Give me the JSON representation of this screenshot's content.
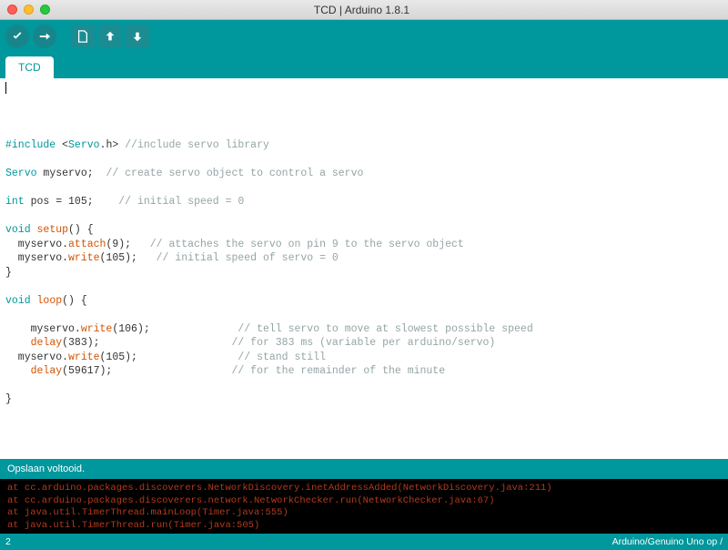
{
  "window": {
    "title": "TCD | Arduino 1.8.1"
  },
  "tabs": [
    {
      "label": "TCD"
    }
  ],
  "statusbar": {
    "text": "Opslaan voltooid."
  },
  "footer": {
    "left": "2",
    "right": "Arduino/Genuino Uno op /"
  },
  "console": {
    "lines": [
      "at cc.arduino.packages.discoverers.NetworkDiscovery.inetAddressAdded(NetworkDiscovery.java:211)",
      "at cc.arduino.packages.discoverers.network.NetworkChecker.run(NetworkChecker.java:67)",
      "at java.util.TimerThread.mainLoop(Timer.java:555)",
      "at java.util.TimerThread.run(Timer.java:505)"
    ]
  },
  "code": {
    "tokens": [
      [
        {
          "t": ""
        }
      ],
      [
        {
          "c": "kw",
          "t": "#include"
        },
        {
          "t": " <"
        },
        {
          "c": "ty",
          "t": "Servo"
        },
        {
          "t": ".h> "
        },
        {
          "c": "cm",
          "t": "//include servo library"
        }
      ],
      [
        {
          "t": ""
        }
      ],
      [
        {
          "c": "ty",
          "t": "Servo"
        },
        {
          "t": " myservo;  "
        },
        {
          "c": "cm",
          "t": "// create servo object to control a servo"
        }
      ],
      [
        {
          "t": ""
        }
      ],
      [
        {
          "c": "ty",
          "t": "int"
        },
        {
          "t": " pos = 105;    "
        },
        {
          "c": "cm",
          "t": "// initial speed = 0"
        }
      ],
      [
        {
          "t": ""
        }
      ],
      [
        {
          "c": "ty",
          "t": "void"
        },
        {
          "t": " "
        },
        {
          "c": "fn",
          "t": "setup"
        },
        {
          "t": "() {"
        }
      ],
      [
        {
          "t": "  myservo."
        },
        {
          "c": "fn",
          "t": "attach"
        },
        {
          "t": "(9);   "
        },
        {
          "c": "cm",
          "t": "// attaches the servo on pin 9 to the servo object"
        }
      ],
      [
        {
          "t": "  myservo."
        },
        {
          "c": "fn",
          "t": "write"
        },
        {
          "t": "(105);   "
        },
        {
          "c": "cm",
          "t": "// initial speed of servo = 0"
        }
      ],
      [
        {
          "t": "}"
        }
      ],
      [
        {
          "t": ""
        }
      ],
      [
        {
          "c": "ty",
          "t": "void"
        },
        {
          "t": " "
        },
        {
          "c": "fn",
          "t": "loop"
        },
        {
          "t": "() {"
        }
      ],
      [
        {
          "t": ""
        }
      ],
      [
        {
          "t": "    myservo."
        },
        {
          "c": "fn",
          "t": "write"
        },
        {
          "t": "(106);              "
        },
        {
          "c": "cm",
          "t": "// tell servo to move at slowest possible speed"
        }
      ],
      [
        {
          "t": "    "
        },
        {
          "c": "fn",
          "t": "delay"
        },
        {
          "t": "(383);                     "
        },
        {
          "c": "cm",
          "t": "// for 383 ms (variable per arduino/servo)"
        }
      ],
      [
        {
          "t": "  myservo."
        },
        {
          "c": "fn",
          "t": "write"
        },
        {
          "t": "(105);                "
        },
        {
          "c": "cm",
          "t": "// stand still"
        }
      ],
      [
        {
          "t": "    "
        },
        {
          "c": "fn",
          "t": "delay"
        },
        {
          "t": "(59617);                   "
        },
        {
          "c": "cm",
          "t": "// for the remainder of the minute"
        }
      ],
      [
        {
          "t": ""
        }
      ],
      [
        {
          "t": "}"
        }
      ]
    ]
  },
  "colors": {
    "teal": "#00979d"
  }
}
